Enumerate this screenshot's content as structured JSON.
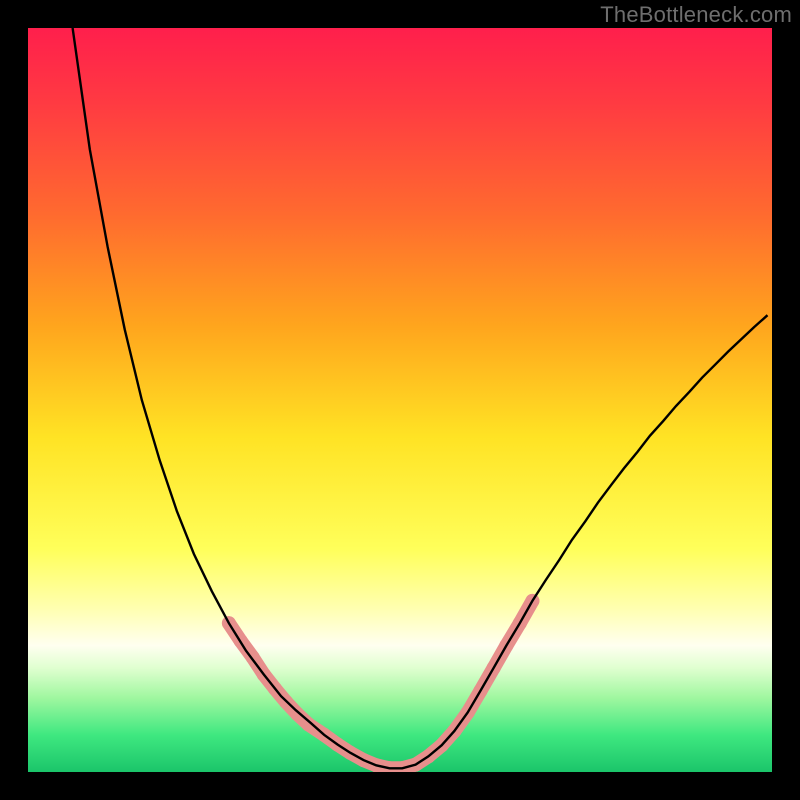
{
  "watermark": "TheBottleneck.com",
  "chart_data": {
    "type": "line",
    "title": "",
    "xlabel": "",
    "ylabel": "",
    "xlim": [
      0,
      1
    ],
    "ylim": [
      0,
      1
    ],
    "gradient_stops": [
      {
        "offset": 0.0,
        "color": "#ff1f4c"
      },
      {
        "offset": 0.1,
        "color": "#ff3a42"
      },
      {
        "offset": 0.25,
        "color": "#ff6a2f"
      },
      {
        "offset": 0.4,
        "color": "#ffa51d"
      },
      {
        "offset": 0.55,
        "color": "#ffe324"
      },
      {
        "offset": 0.7,
        "color": "#ffff5a"
      },
      {
        "offset": 0.78,
        "color": "#ffffb0"
      },
      {
        "offset": 0.83,
        "color": "#fffff0"
      },
      {
        "offset": 0.86,
        "color": "#e0ffd0"
      },
      {
        "offset": 0.9,
        "color": "#a0f7a0"
      },
      {
        "offset": 0.95,
        "color": "#3fe880"
      },
      {
        "offset": 1.0,
        "color": "#1bc56a"
      }
    ],
    "series": [
      {
        "name": "bottleneck-curve",
        "color": "#000000",
        "x": [
          0.06,
          0.083,
          0.107,
          0.13,
          0.153,
          0.177,
          0.2,
          0.223,
          0.247,
          0.27,
          0.293,
          0.317,
          0.34,
          0.36,
          0.38,
          0.398,
          0.416,
          0.433,
          0.451,
          0.468,
          0.486,
          0.503,
          0.521,
          0.538,
          0.556,
          0.573,
          0.591,
          0.608,
          0.626,
          0.643,
          0.661,
          0.678,
          0.696,
          0.714,
          0.731,
          0.749,
          0.766,
          0.784,
          0.801,
          0.819,
          0.836,
          0.854,
          0.871,
          0.889,
          0.906,
          0.924,
          0.941,
          0.959,
          0.976,
          0.994
        ],
        "y": [
          1.0,
          0.837,
          0.706,
          0.595,
          0.5,
          0.419,
          0.351,
          0.293,
          0.243,
          0.2,
          0.163,
          0.131,
          0.102,
          0.083,
          0.066,
          0.05,
          0.037,
          0.026,
          0.016,
          0.009,
          0.005,
          0.005,
          0.01,
          0.021,
          0.036,
          0.055,
          0.08,
          0.109,
          0.14,
          0.17,
          0.2,
          0.23,
          0.258,
          0.285,
          0.312,
          0.337,
          0.362,
          0.386,
          0.408,
          0.43,
          0.452,
          0.472,
          0.492,
          0.511,
          0.53,
          0.548,
          0.565,
          0.582,
          0.598,
          0.614
        ]
      }
    ],
    "markers": {
      "name": "highlighted-segments",
      "color": "#e78f8c",
      "points": [
        {
          "x": 0.27,
          "y": 0.2
        },
        {
          "x": 0.286,
          "y": 0.176
        },
        {
          "x": 0.302,
          "y": 0.154
        },
        {
          "x": 0.317,
          "y": 0.131
        },
        {
          "x": 0.332,
          "y": 0.112
        },
        {
          "x": 0.347,
          "y": 0.094
        },
        {
          "x": 0.362,
          "y": 0.078
        },
        {
          "x": 0.377,
          "y": 0.064
        },
        {
          "x": 0.398,
          "y": 0.05
        },
        {
          "x": 0.416,
          "y": 0.037
        },
        {
          "x": 0.433,
          "y": 0.026
        },
        {
          "x": 0.451,
          "y": 0.016
        },
        {
          "x": 0.468,
          "y": 0.009
        },
        {
          "x": 0.486,
          "y": 0.005
        },
        {
          "x": 0.503,
          "y": 0.005
        },
        {
          "x": 0.521,
          "y": 0.01
        },
        {
          "x": 0.538,
          "y": 0.021
        },
        {
          "x": 0.556,
          "y": 0.036
        },
        {
          "x": 0.573,
          "y": 0.055
        },
        {
          "x": 0.591,
          "y": 0.08
        },
        {
          "x": 0.608,
          "y": 0.109
        },
        {
          "x": 0.626,
          "y": 0.14
        },
        {
          "x": 0.643,
          "y": 0.17
        },
        {
          "x": 0.661,
          "y": 0.2
        },
        {
          "x": 0.678,
          "y": 0.23
        }
      ]
    }
  }
}
